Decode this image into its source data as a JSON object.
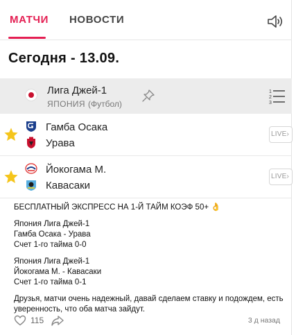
{
  "tabs": [
    {
      "label": "МАТЧИ",
      "active": true
    },
    {
      "label": "НОВОСТИ",
      "active": false
    }
  ],
  "icons": {
    "sound": "speaker-icon",
    "pin": "pin-icon",
    "standings": "standings-icon",
    "favorite": "star-icon",
    "like": "heart-icon",
    "share": "share-icon"
  },
  "colors": {
    "accent": "#e41e52",
    "star": "#f5c51b",
    "league_bg": "#ececec"
  },
  "date_title": "Сегодня - 13.09.",
  "league": {
    "name": "Лига Джей-1",
    "country": "ЯПОНИЯ",
    "sport": "(Футбол)"
  },
  "matches": [
    {
      "home": "Гамба Осака",
      "away": "Урава",
      "live_label": "LIVE",
      "favorite": true
    },
    {
      "home": "Йокогама М.",
      "away": "Кавасаки",
      "live_label": "LIVE",
      "favorite": true
    }
  ],
  "post": {
    "headline": "БЕСПЛАТНЫЙ ЭКСПРЕСС НА 1-Й ТАЙМ КОЭФ 50+ 👌",
    "blocks": [
      {
        "league": "Япония Лига Джей-1",
        "match": "Гамба Осака - Урава",
        "score": "Счет 1-го тайма 0-0"
      },
      {
        "league": "Япония Лига Джей-1",
        "match": "Йокогама М. - Кавасаки",
        "score": "Счет 1-го тайма 0-1"
      }
    ],
    "comment": "Друзья, матчи очень надежный, давай сделаем ставку и подождем, есть уверенность, что оба матча зайдут.",
    "likes": "115",
    "time_ago": "3 д назад"
  }
}
